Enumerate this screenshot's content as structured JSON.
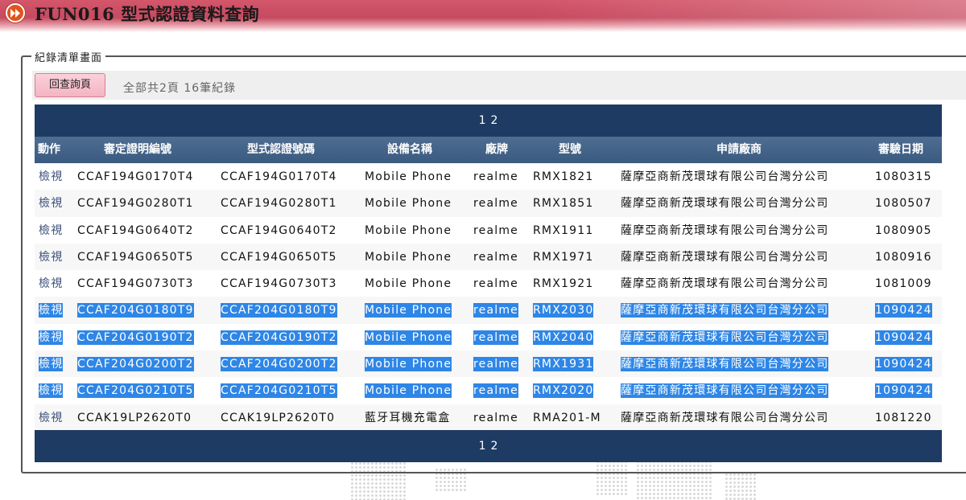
{
  "header": {
    "title": "FUN016 型式認證資料查詢",
    "icon": "fast-forward-icon"
  },
  "panel": {
    "legend": "紀錄清單畫面",
    "back_button": "回查詢頁",
    "summary": "全部共2頁  16筆紀錄"
  },
  "pager": {
    "pages": [
      "1",
      "2"
    ]
  },
  "table": {
    "columns": [
      "動作",
      "審定證明編號",
      "型式認證號碼",
      "設備名稱",
      "廠牌",
      "型號",
      "申請廠商",
      "審驗日期"
    ],
    "rows": [
      {
        "action": "檢視",
        "cert_no": "CCAF194G0170T4",
        "type_no": "CCAF194G0170T4",
        "device": "Mobile Phone",
        "brand": "realme",
        "model": "RMX1821",
        "applicant": "薩摩亞商新茂環球有限公司台灣分公司",
        "date": "1080315",
        "selected": false
      },
      {
        "action": "檢視",
        "cert_no": "CCAF194G0280T1",
        "type_no": "CCAF194G0280T1",
        "device": "Mobile Phone",
        "brand": "realme",
        "model": "RMX1851",
        "applicant": "薩摩亞商新茂環球有限公司台灣分公司",
        "date": "1080507",
        "selected": false
      },
      {
        "action": "檢視",
        "cert_no": "CCAF194G0640T2",
        "type_no": "CCAF194G0640T2",
        "device": "Mobile Phone",
        "brand": "realme",
        "model": "RMX1911",
        "applicant": "薩摩亞商新茂環球有限公司台灣分公司",
        "date": "1080905",
        "selected": false
      },
      {
        "action": "檢視",
        "cert_no": "CCAF194G0650T5",
        "type_no": "CCAF194G0650T5",
        "device": "Mobile Phone",
        "brand": "realme",
        "model": "RMX1971",
        "applicant": "薩摩亞商新茂環球有限公司台灣分公司",
        "date": "1080916",
        "selected": false
      },
      {
        "action": "檢視",
        "cert_no": "CCAF194G0730T3",
        "type_no": "CCAF194G0730T3",
        "device": "Mobile Phone",
        "brand": "realme",
        "model": "RMX1921",
        "applicant": "薩摩亞商新茂環球有限公司台灣分公司",
        "date": "1081009",
        "selected": false
      },
      {
        "action": "檢視",
        "cert_no": "CCAF204G0180T9",
        "type_no": "CCAF204G0180T9",
        "device": "Mobile Phone",
        "brand": "realme",
        "model": "RMX2030",
        "applicant": "薩摩亞商新茂環球有限公司台灣分公司",
        "date": "1090424",
        "selected": true
      },
      {
        "action": "檢視",
        "cert_no": "CCAF204G0190T2",
        "type_no": "CCAF204G0190T2",
        "device": "Mobile Phone",
        "brand": "realme",
        "model": "RMX2040",
        "applicant": "薩摩亞商新茂環球有限公司台灣分公司",
        "date": "1090424",
        "selected": true
      },
      {
        "action": "檢視",
        "cert_no": "CCAF204G0200T2",
        "type_no": "CCAF204G0200T2",
        "device": "Mobile Phone",
        "brand": "realme",
        "model": "RMX1931",
        "applicant": "薩摩亞商新茂環球有限公司台灣分公司",
        "date": "1090424",
        "selected": true
      },
      {
        "action": "檢視",
        "cert_no": "CCAF204G0210T5",
        "type_no": "CCAF204G0210T5",
        "device": "Mobile Phone",
        "brand": "realme",
        "model": "RMX2020",
        "applicant": "薩摩亞商新茂環球有限公司台灣分公司",
        "date": "1090424",
        "selected": true
      },
      {
        "action": "檢視",
        "cert_no": "CCAK19LP2620T0",
        "type_no": "CCAK19LP2620T0",
        "device": "藍牙耳機充電盒",
        "brand": "realme",
        "model": "RMA201-M",
        "applicant": "薩摩亞商新茂環球有限公司台灣分公司",
        "date": "1081220",
        "selected": false
      }
    ]
  },
  "colors": {
    "banner": "#c64a60",
    "table_header": "#1d3b63",
    "selection": "#2e86e6",
    "link": "#3a4f7a"
  }
}
